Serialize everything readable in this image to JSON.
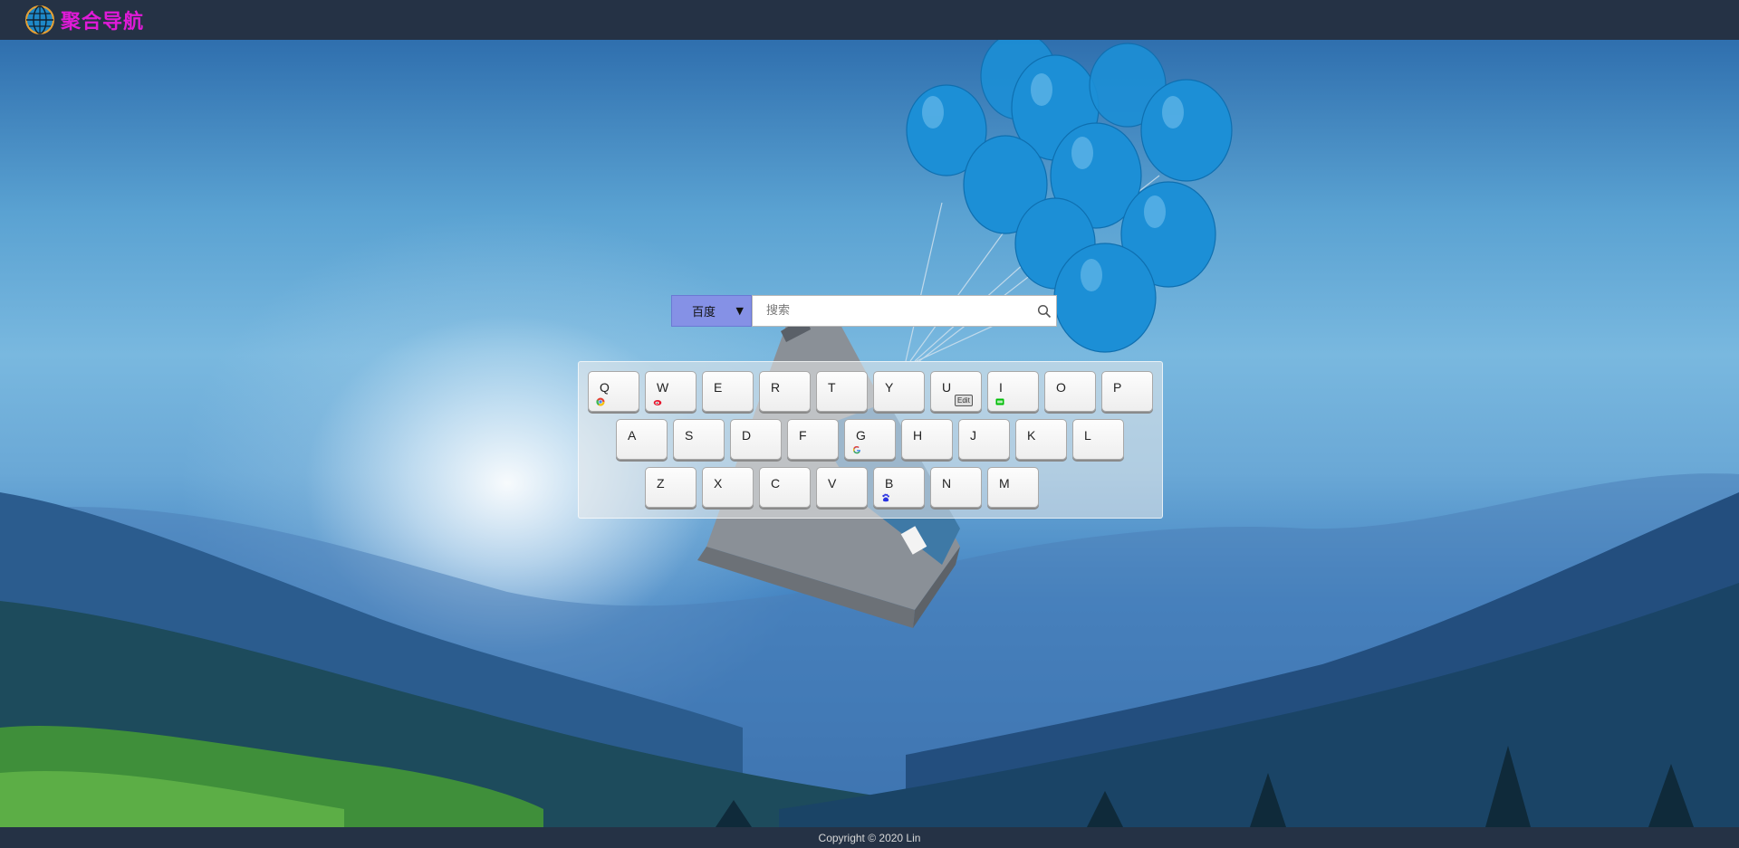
{
  "header": {
    "logo_text": "聚合导航",
    "logo_icon": "globe-icon"
  },
  "search": {
    "engine_selected": "百度",
    "placeholder": "搜索",
    "value": "",
    "button_icon": "search-icon"
  },
  "keyboard": {
    "rows": [
      [
        {
          "key": "Q",
          "favicon": "chrome-icon"
        },
        {
          "key": "W",
          "favicon": "weibo-icon"
        },
        {
          "key": "E"
        },
        {
          "key": "R"
        },
        {
          "key": "T"
        },
        {
          "key": "Y"
        },
        {
          "key": "U",
          "badge": "Edit"
        },
        {
          "key": "I",
          "favicon": "iqiyi-icon"
        },
        {
          "key": "O"
        },
        {
          "key": "P"
        }
      ],
      [
        {
          "key": "A"
        },
        {
          "key": "S"
        },
        {
          "key": "D"
        },
        {
          "key": "F"
        },
        {
          "key": "G",
          "favicon": "google-icon"
        },
        {
          "key": "H"
        },
        {
          "key": "J"
        },
        {
          "key": "K"
        },
        {
          "key": "L"
        }
      ],
      [
        {
          "key": "Z"
        },
        {
          "key": "X"
        },
        {
          "key": "C"
        },
        {
          "key": "V"
        },
        {
          "key": "B",
          "favicon": "baidu-icon"
        },
        {
          "key": "N"
        },
        {
          "key": "M"
        }
      ]
    ]
  },
  "footer": {
    "copyright": "Copyright © 2020 Lin"
  },
  "colors": {
    "bar": "#253245",
    "logo": "#e01ad8",
    "engine_select": "#8591e6"
  }
}
